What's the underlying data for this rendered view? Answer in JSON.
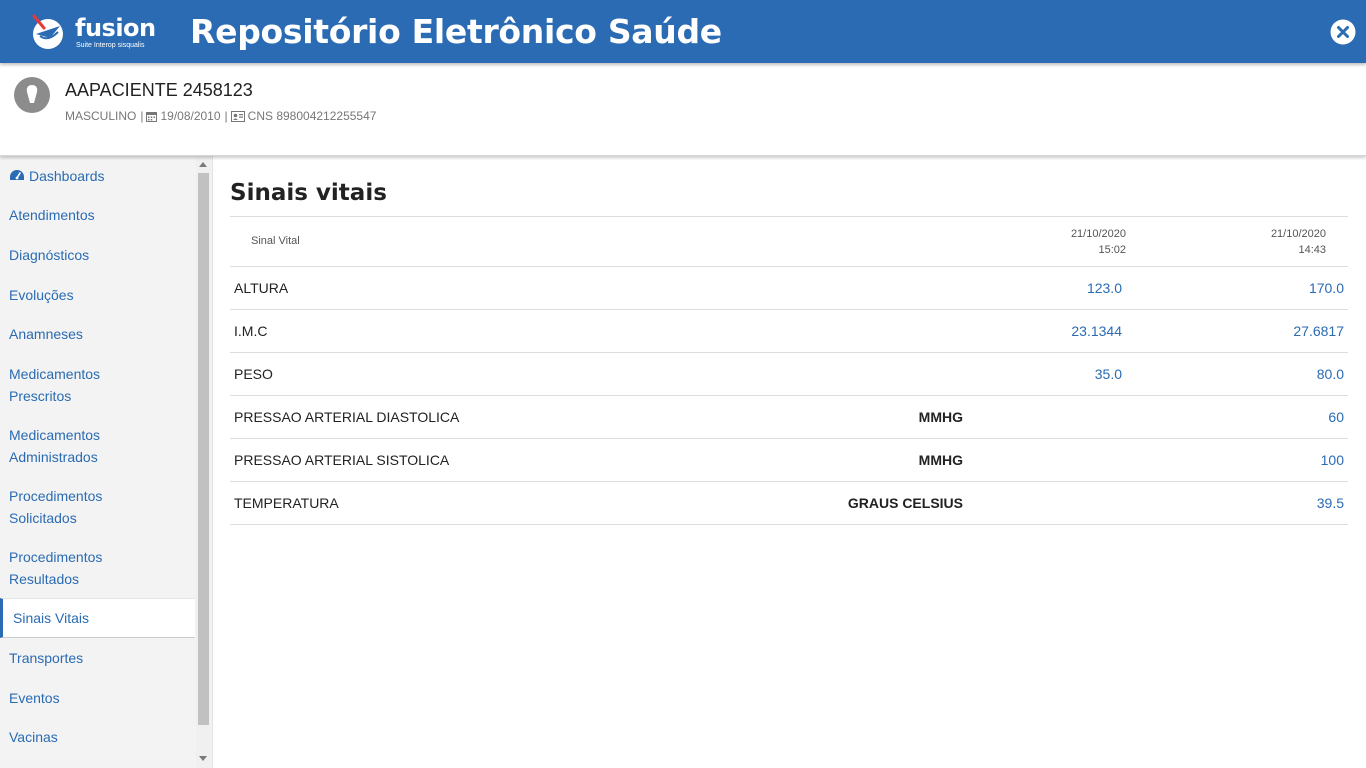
{
  "header": {
    "logo_text": "fusion",
    "logo_tagline": "Suite Interop sisqualis",
    "title": "Repositório Eletrônico Saúde",
    "close_icon": "close-circle-icon"
  },
  "patient": {
    "name": "AAPACIENTE 2458123",
    "sex": "MASCULINO",
    "separator": "|",
    "birth_date": "19/08/2010",
    "cns": "CNS 898004212255547"
  },
  "sidebar": {
    "items": [
      {
        "label": "Dashboards",
        "icon": "dashboard-icon"
      },
      {
        "label": "Atendimentos"
      },
      {
        "label": "Diagnósticos"
      },
      {
        "label": "Evoluções"
      },
      {
        "label": "Anamneses"
      },
      {
        "label": "Medicamentos",
        "label2": "Prescritos"
      },
      {
        "label": "Medicamentos",
        "label2": "Administrados"
      },
      {
        "label": "Procedimentos",
        "label2": "Solicitados"
      },
      {
        "label": "Procedimentos",
        "label2": "Resultados"
      },
      {
        "label": "Sinais Vitais",
        "active": true
      },
      {
        "label": "Transportes"
      },
      {
        "label": "Eventos"
      },
      {
        "label": "Vacinas"
      }
    ]
  },
  "main": {
    "title": "Sinais vitais",
    "table": {
      "label_header": "Sinal Vital",
      "columns": [
        {
          "date": "21/10/2020",
          "time": "15:02"
        },
        {
          "date": "21/10/2020",
          "time": "14:43"
        }
      ],
      "rows": [
        {
          "name": "ALTURA",
          "unit": "",
          "v1": "123.0",
          "v2": "170.0"
        },
        {
          "name": "I.M.C",
          "unit": "",
          "v1": "23.1344",
          "v2": "27.6817"
        },
        {
          "name": "PESO",
          "unit": "",
          "v1": "35.0",
          "v2": "80.0"
        },
        {
          "name": "PRESSAO ARTERIAL DIASTOLICA",
          "unit": "MMHG",
          "v1": "",
          "v2": "60"
        },
        {
          "name": "PRESSAO ARTERIAL SISTOLICA",
          "unit": "MMHG",
          "v1": "",
          "v2": "100"
        },
        {
          "name": "TEMPERATURA",
          "unit": "GRAUS CELSIUS",
          "v1": "",
          "v2": "39.5"
        }
      ]
    }
  },
  "colors": {
    "brand": "#2a6bb3",
    "link": "#2a6bb3",
    "sidebar_bg": "#f3f3f3"
  }
}
